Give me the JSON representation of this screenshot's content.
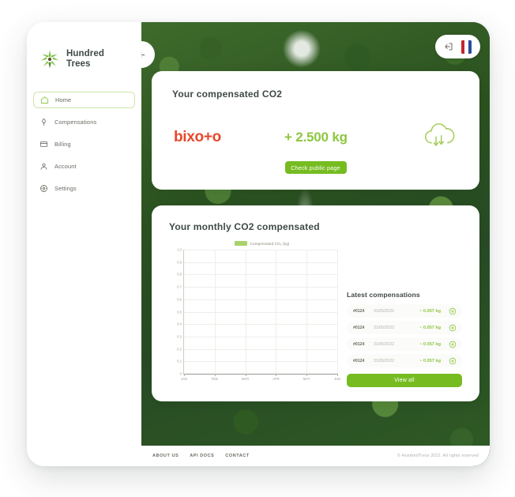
{
  "brand": {
    "name_line1": "Hundred",
    "name_line2": "Trees",
    "logo_icon": "trees-starburst-icon"
  },
  "sidebar": {
    "items": [
      {
        "label": "Home",
        "icon": "home-icon",
        "active": true
      },
      {
        "label": "Compensations",
        "icon": "tree-icon",
        "active": false
      },
      {
        "label": "Billing",
        "icon": "card-icon",
        "active": false
      },
      {
        "label": "Account",
        "icon": "person-icon",
        "active": false
      },
      {
        "label": "Settings",
        "icon": "gear-icon",
        "active": false
      }
    ]
  },
  "header": {
    "collapse_icon": "arrow-left-icon",
    "logout_icon": "logout-icon",
    "language_flag": "french-flag-icon"
  },
  "summary_card": {
    "title": "Your compensated CO2",
    "partner_logo_text": "bixo+o",
    "value": "+ 2.500 kg",
    "cloud_icon": "cloud-co2-icon",
    "button_label": "Check public page"
  },
  "chart_card": {
    "title": "Your monthly CO2 compensated"
  },
  "chart_data": {
    "type": "bar",
    "title": "Your monthly CO2 compensated",
    "categories": [
      "JAN",
      "FEB",
      "MAR",
      "APR",
      "MAY",
      "JUN"
    ],
    "series": [
      {
        "name": "Compensated CO₂ (kg)",
        "values": [
          0,
          0,
          0,
          0,
          0,
          0
        ],
        "color": "#a9d26b"
      }
    ],
    "xlabel": "",
    "ylabel": "",
    "ylim": [
      0,
      1
    ],
    "yticks": [
      "0",
      "0.1",
      "0.2",
      "0.3",
      "0.4",
      "0.5",
      "0.6",
      "0.7",
      "0.8",
      "0.9",
      "1.0"
    ],
    "grid": true,
    "legend_position": "top-center",
    "legend": [
      "Compensated CO₂ (kg)"
    ]
  },
  "latest": {
    "title": "Latest compensations",
    "rows": [
      {
        "id": "#0124",
        "date": "31/05/2022",
        "amount": "~ 0.057 kg",
        "action_icon": "plus-circle-icon"
      },
      {
        "id": "#0124",
        "date": "31/05/2022",
        "amount": "~ 0.057 kg",
        "action_icon": "plus-circle-icon"
      },
      {
        "id": "#0124",
        "date": "31/05/2022",
        "amount": "~ 0.057 kg",
        "action_icon": "plus-circle-icon"
      },
      {
        "id": "#0124",
        "date": "31/05/2022",
        "amount": "~ 0.057 kg",
        "action_icon": "plus-circle-icon"
      }
    ],
    "view_all_label": "View all"
  },
  "footer": {
    "links": [
      "ABOUT US",
      "API DOCS",
      "CONTACT"
    ],
    "copyright": "© HundredTress 2022. All rights reserved"
  },
  "colors": {
    "accent_green": "#8dc63f",
    "button_green": "#76bc21",
    "partner_orange": "#e8492a",
    "text_dark": "#3f4a44",
    "text_muted": "#b6b2ab"
  }
}
